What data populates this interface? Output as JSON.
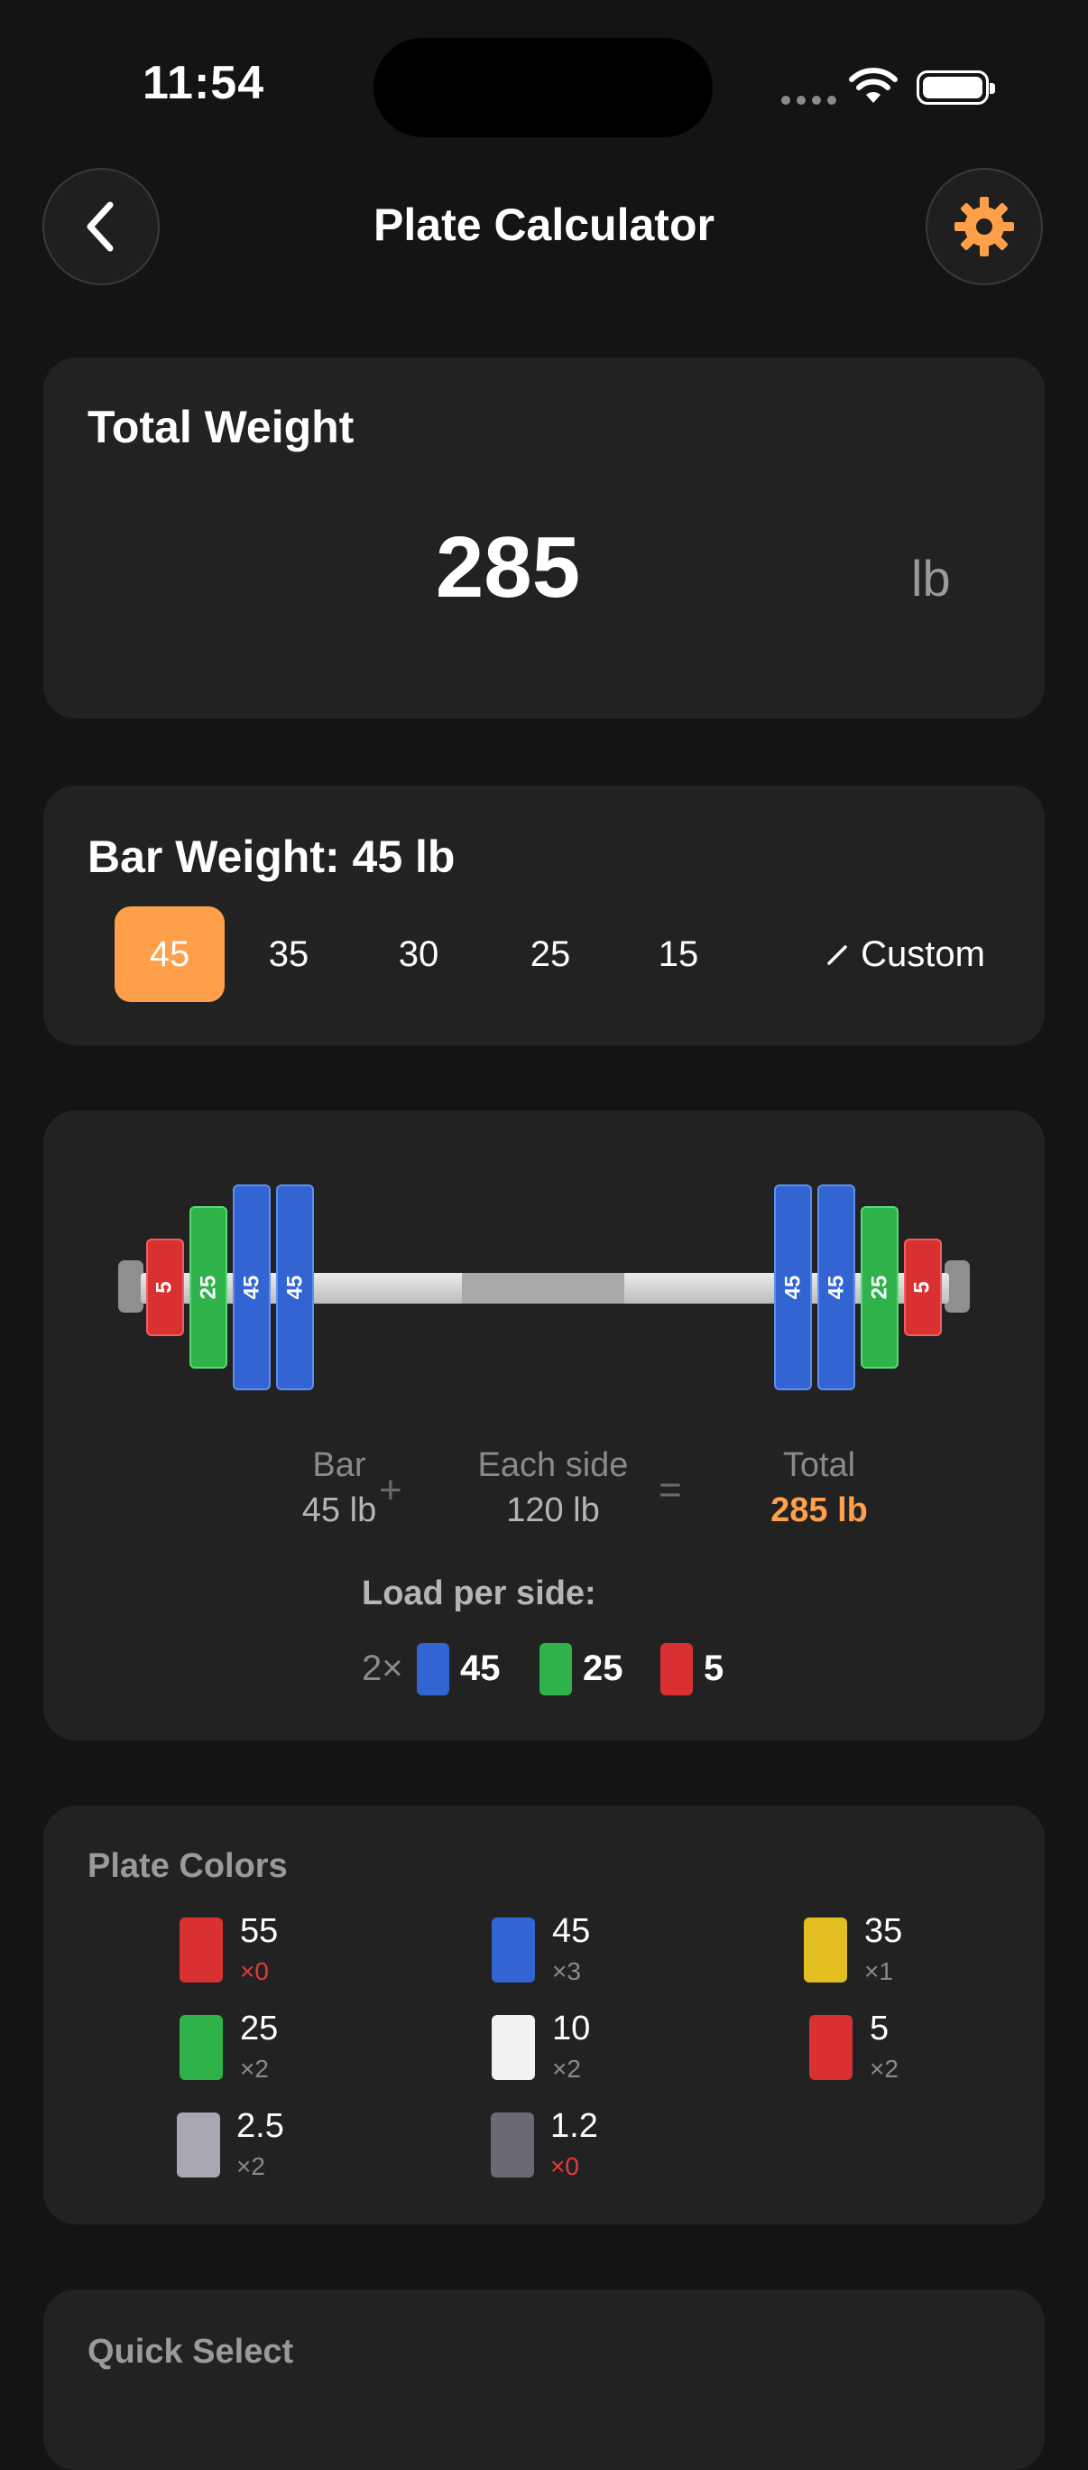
{
  "status": {
    "time": "11:54"
  },
  "nav": {
    "title": "Plate Calculator"
  },
  "total_weight": {
    "title": "Total Weight",
    "value": "285",
    "unit": "lb"
  },
  "bar_weight": {
    "title": "Bar Weight: 45 lb",
    "options": [
      "45",
      "35",
      "30",
      "25",
      "15"
    ],
    "selected": "45",
    "custom_label": "Custom"
  },
  "barbell": {
    "left_plates": [
      "5",
      "25",
      "45",
      "45"
    ],
    "right_plates": [
      "45",
      "45",
      "25",
      "5"
    ],
    "bar_label": "Bar",
    "bar_value": "45 lb",
    "plus": "+",
    "side_label": "Each side",
    "side_value": "120 lb",
    "equals": "=",
    "total_label": "Total",
    "total_value": "285 lb"
  },
  "load_per_side": {
    "title": "Load per side:",
    "items": [
      {
        "count": "2×",
        "weight": "45",
        "color": "#3264D2"
      },
      {
        "count": "",
        "weight": "25",
        "color": "#2DB34A"
      },
      {
        "count": "",
        "weight": "5",
        "color": "#D93131"
      }
    ]
  },
  "plate_colors": {
    "title": "Plate Colors",
    "items": [
      {
        "weight": "55",
        "count": "×0",
        "color": "#D93131"
      },
      {
        "weight": "45",
        "count": "×3",
        "color": "#3264D2"
      },
      {
        "weight": "35",
        "count": "×1",
        "color": "#E2BE1E"
      },
      {
        "weight": "25",
        "count": "×2",
        "color": "#2DB34A"
      },
      {
        "weight": "10",
        "count": "×2",
        "color": "#F2F2F2"
      },
      {
        "weight": "5",
        "count": "×2",
        "color": "#D93131"
      },
      {
        "weight": "2.5",
        "count": "×2",
        "color": "#A8A8B2"
      },
      {
        "weight": "1.2",
        "count": "×0",
        "color": "#6A6A74"
      }
    ]
  },
  "quick_select": {
    "title": "Quick Select"
  },
  "colors": {
    "accent": "#FF9F4A",
    "background": "#141414",
    "card": "#222222"
  }
}
